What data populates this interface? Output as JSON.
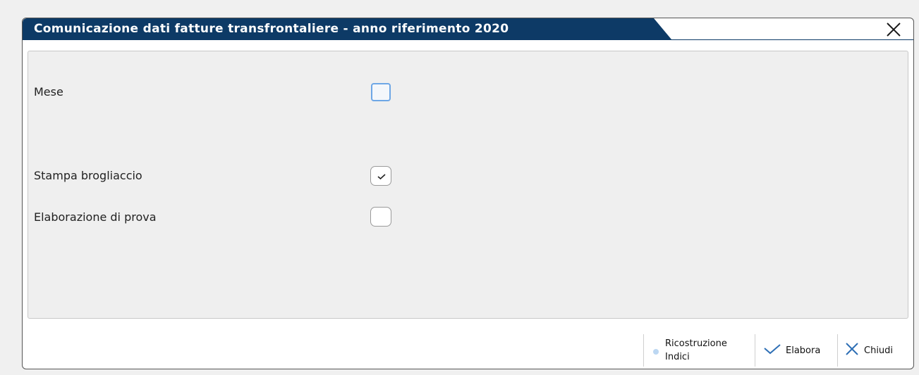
{
  "window": {
    "title": "Comunicazione dati fatture transfrontaliere - anno riferimento 2020"
  },
  "form": {
    "mese_label": "Mese",
    "mese_value": "",
    "stampa_label": "Stampa brogliaccio",
    "stampa_checked": true,
    "prova_label": "Elaborazione di prova",
    "prova_checked": false
  },
  "footer": {
    "ricostruzione_label": "Ricostruzione\nIndici",
    "elabora_label": "Elabora",
    "chiudi_label": "Chiudi"
  },
  "icons": {
    "close": "close-icon",
    "dot": "dot-icon",
    "check": "check-icon",
    "cross": "cross-icon"
  },
  "colors": {
    "title_bar": "#0d3a66",
    "field_focus": "#6ea7e6",
    "icon_blue": "#2e6fb5"
  }
}
